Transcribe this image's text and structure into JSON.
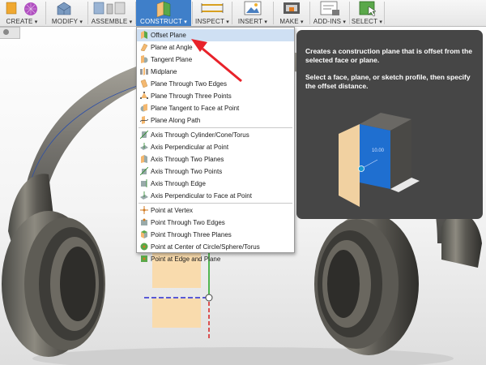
{
  "toolbar": {
    "groups": [
      {
        "id": "create",
        "label": "CREATE"
      },
      {
        "id": "modify",
        "label": "MODIFY"
      },
      {
        "id": "assemble",
        "label": "ASSEMBLE"
      },
      {
        "id": "construct",
        "label": "CONSTRUCT"
      },
      {
        "id": "inspect",
        "label": "INSPECT"
      },
      {
        "id": "insert",
        "label": "INSERT"
      },
      {
        "id": "make",
        "label": "MAKE"
      },
      {
        "id": "addins",
        "label": "ADD-INS"
      },
      {
        "id": "select",
        "label": "SELECT"
      }
    ],
    "active": "construct"
  },
  "menu": {
    "close_label": "×",
    "items": [
      {
        "label": "Offset Plane",
        "icon": "offset-plane-icon",
        "highlighted": true
      },
      {
        "label": "Plane at Angle",
        "icon": "plane-at-angle-icon"
      },
      {
        "label": "Tangent Plane",
        "icon": "tangent-plane-icon"
      },
      {
        "label": "Midplane",
        "icon": "midplane-icon"
      },
      {
        "label": "Plane Through Two Edges",
        "icon": "plane-two-edges-icon"
      },
      {
        "label": "Plane Through Three Points",
        "icon": "plane-three-points-icon"
      },
      {
        "label": "Plane Tangent to Face at Point",
        "icon": "plane-tangent-face-icon"
      },
      {
        "label": "Plane Along Path",
        "icon": "plane-along-path-icon"
      },
      {
        "label": "Axis Through Cylinder/Cone/Torus",
        "icon": "axis-cylinder-icon"
      },
      {
        "label": "Axis Perpendicular at Point",
        "icon": "axis-perpendicular-point-icon"
      },
      {
        "label": "Axis Through Two Planes",
        "icon": "axis-two-planes-icon"
      },
      {
        "label": "Axis Through Two Points",
        "icon": "axis-two-points-icon"
      },
      {
        "label": "Axis Through Edge",
        "icon": "axis-edge-icon"
      },
      {
        "label": "Axis Perpendicular to Face at Point",
        "icon": "axis-perpendicular-face-icon"
      },
      {
        "label": "Point at Vertex",
        "icon": "point-vertex-icon"
      },
      {
        "label": "Point Through Two Edges",
        "icon": "point-two-edges-icon"
      },
      {
        "label": "Point Through Three Planes",
        "icon": "point-three-planes-icon"
      },
      {
        "label": "Point at Center of Circle/Sphere/Torus",
        "icon": "point-center-circle-icon"
      },
      {
        "label": "Point at Edge and Plane",
        "icon": "point-edge-plane-icon"
      }
    ]
  },
  "tooltip": {
    "line1": "Creates a construction plane that is offset from the selected face or plane.",
    "line2": "Select a face, plane, or sketch profile, then specify the offset distance.",
    "illustration_value": "10.00"
  },
  "colors": {
    "highlight": "#cfe0f3",
    "toolbar_active": "#3f7fc9",
    "tooltip_bg": "#464646",
    "plane_orange": "#fbd9a6",
    "cube_blue": "#1f6fd0",
    "arrow_red": "#e8222a"
  }
}
